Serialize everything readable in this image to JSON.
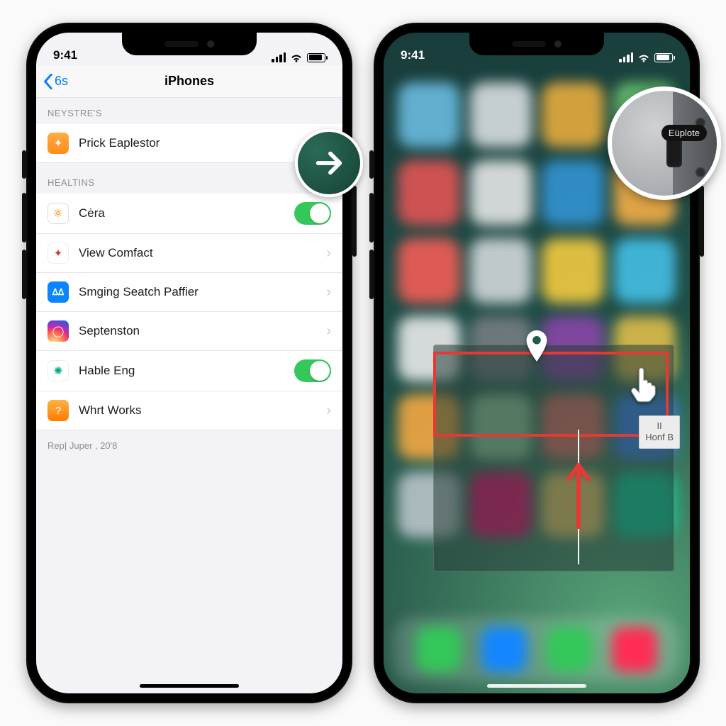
{
  "status": {
    "time": "9:41"
  },
  "left": {
    "back_label": "6s",
    "title": "iPhones",
    "section1": "NEYSTRE'S",
    "section2": "HEALTINS",
    "rows": {
      "r0": "Prick Eaplestor",
      "r1": "Cėra",
      "r2": "View Comfact",
      "r3": "Smging Seatch Paffier",
      "r4": "Septenston",
      "r5": "Hable Eng",
      "r6": "Whrt Works"
    },
    "footer": "Rep| Juper , 20'8"
  },
  "right": {
    "callout_label": "Eüplote",
    "tooltip_line1": "II",
    "tooltip_line2": "Honf B"
  },
  "colors": {
    "ios_blue": "#007aff",
    "toggle_green": "#34c759",
    "highlight_red": "#e53935",
    "badge_green": "#1f5a48"
  }
}
